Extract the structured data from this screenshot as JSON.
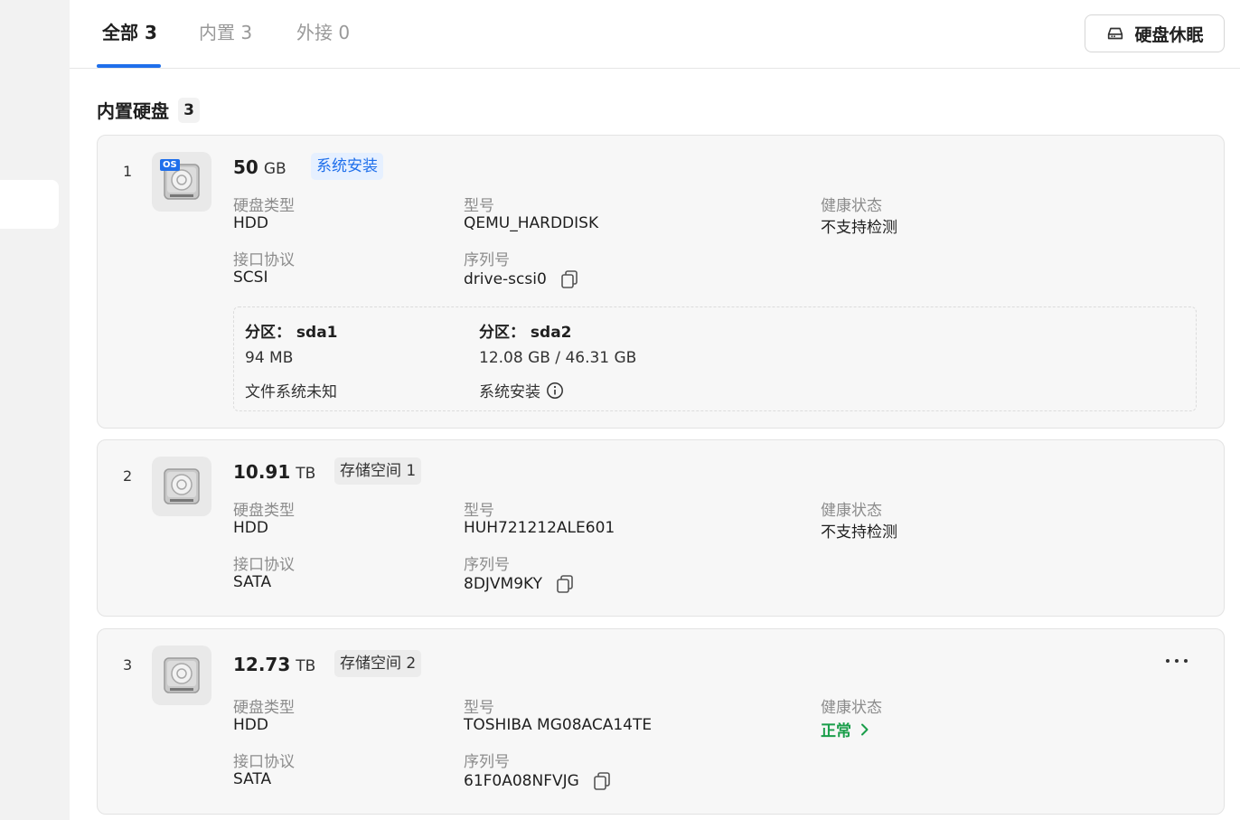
{
  "tabs": [
    {
      "label": "全部 3",
      "active": true
    },
    {
      "label": "内置 3",
      "active": false
    },
    {
      "label": "外接 0",
      "active": false
    }
  ],
  "sleep_button": {
    "label": "硬盘休眠",
    "icon": "hdd-icon"
  },
  "section": {
    "title": "内置硬盘",
    "count": "3"
  },
  "labels": {
    "disk_type": "硬盘类型",
    "interface": "接口协议",
    "model": "型号",
    "serial": "序列号",
    "health": "健康状态"
  },
  "disks": [
    {
      "index": "1",
      "size_value": "50",
      "size_unit": "GB",
      "os_badge": "OS",
      "tag": "系统安装",
      "type": "HDD",
      "interface": "SCSI",
      "model": "QEMU_HARDDISK",
      "serial": "drive-scsi0",
      "health": "不支持检测",
      "partitions": [
        {
          "title": "分区：  sda1",
          "size": "94 MB",
          "fs": "文件系统未知"
        },
        {
          "title": "分区：  sda2",
          "size": "12.08 GB / 46.31 GB",
          "fs": "系统安装"
        }
      ]
    },
    {
      "index": "2",
      "size_value": "10.91",
      "size_unit": "TB",
      "tag": "存储空间 1",
      "type": "HDD",
      "interface": "SATA",
      "model": "HUH721212ALE601",
      "serial": "8DJVM9KY",
      "health": "不支持检测"
    },
    {
      "index": "3",
      "size_value": "12.73",
      "size_unit": "TB",
      "tag": "存储空间 2",
      "type": "HDD",
      "interface": "SATA",
      "model": "TOSHIBA MG08ACA14TE",
      "serial": "61F0A08NFVJG",
      "health": "正常"
    }
  ],
  "colors": {
    "accent": "#1f6feb",
    "healthy": "#1a9e4a",
    "card_bg": "#f7f7f7"
  }
}
